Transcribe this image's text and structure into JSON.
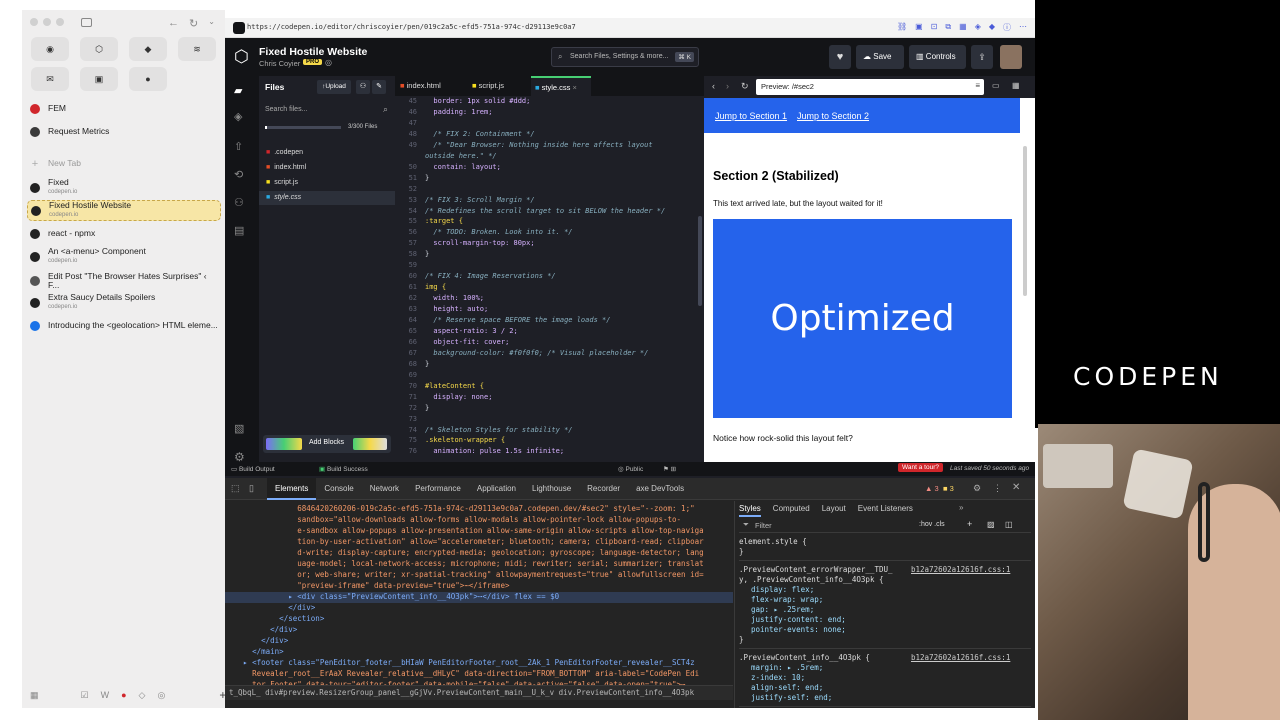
{
  "sidebar": {
    "pinned": [
      {
        "icon": "github-icon",
        "glyph": "◉",
        "bg": "#e2e1e1"
      },
      {
        "icon": "codepen-icon",
        "glyph": "⬡",
        "bg": "#e2e1e1"
      },
      {
        "icon": "app-icon-purple",
        "glyph": "◆",
        "bg": "#e2e1e1"
      },
      {
        "icon": "stack-icon",
        "glyph": "≋",
        "bg": "#e2e1e1"
      },
      {
        "icon": "app-icon-green",
        "glyph": "✉",
        "bg": "#e2e1e1"
      },
      {
        "icon": "app-icon-tile",
        "glyph": "▣",
        "bg": "#e2e1e1"
      },
      {
        "icon": "app-icon-red",
        "glyph": "●",
        "bg": "#e2e1e1"
      }
    ],
    "tabs": [
      {
        "label": "FEM",
        "sub": "",
        "color": "#d0262b"
      },
      {
        "label": "Request Metrics",
        "sub": "",
        "color": "#3a3a3a"
      },
      {
        "label": "New Tab",
        "sub": "",
        "color": "#bbb",
        "plus": true
      },
      {
        "label": "Fixed",
        "sub": "codepen.io",
        "color": "#222"
      },
      {
        "label": "Fixed Hostile Website",
        "sub": "codepen.io",
        "color": "#222",
        "active": true
      },
      {
        "label": "react - npmx",
        "sub": "",
        "color": "#222"
      },
      {
        "label": "An <a-menu> Component",
        "sub": "codepen.io",
        "color": "#222"
      },
      {
        "label": "Edit Post \"The Browser Hates Surprises\" ‹ F...",
        "sub": "",
        "color": "#555"
      },
      {
        "label": "Extra Saucy Details Spoilers",
        "sub": "codepen.io",
        "color": "#222"
      },
      {
        "label": "Introducing the <geolocation> HTML eleme...",
        "sub": "",
        "color": "#1a73e8"
      }
    ]
  },
  "url": "https://codepen.io/editor/chriscoyier/pen/019c2a5c-efd5-751a-974c-d29113e9c0a7",
  "pen": {
    "title": "Fixed Hostile Website",
    "author": "Chris Coyier",
    "badge": "PRO"
  },
  "header": {
    "search_placeholder": "Search Files, Settings & more...",
    "kbd": "⌘ K",
    "save": "Save",
    "controls": "Controls"
  },
  "files": {
    "title": "Files",
    "upload": "Upload",
    "search_placeholder": "Search files...",
    "count": "3/300 Files",
    "items": [
      ".codepen",
      "index.html",
      "script.js",
      "style.css"
    ],
    "add_blocks": "Add Blocks"
  },
  "editor_tabs": [
    "index.html",
    "script.js",
    "style.css"
  ],
  "code_lines": [
    {
      "n": "45",
      "t": "  border: 1px solid #ddd;"
    },
    {
      "n": "46",
      "t": "  padding: 1rem;"
    },
    {
      "n": "47",
      "t": ""
    },
    {
      "n": "48",
      "t": "  /* FIX 2: Containment */"
    },
    {
      "n": "49",
      "t": "  /* \"Dear Browser: Nothing inside here affects layout"
    },
    {
      "n": "",
      "t": "outside here.\" */"
    },
    {
      "n": "50",
      "t": "  contain: layout;"
    },
    {
      "n": "51",
      "t": "}"
    },
    {
      "n": "52",
      "t": ""
    },
    {
      "n": "53",
      "t": "/* FIX 3: Scroll Margin */"
    },
    {
      "n": "54",
      "t": "/* Redefines the scroll target to sit BELOW the header */"
    },
    {
      "n": "55",
      "t": ":target {"
    },
    {
      "n": "56",
      "t": "  /* TODO: Broken. Look into it. */"
    },
    {
      "n": "57",
      "t": "  scroll-margin-top: 80px;"
    },
    {
      "n": "58",
      "t": "}"
    },
    {
      "n": "59",
      "t": ""
    },
    {
      "n": "60",
      "t": "/* FIX 4: Image Reservations */"
    },
    {
      "n": "61",
      "t": "img {"
    },
    {
      "n": "62",
      "t": "  width: 100%;"
    },
    {
      "n": "63",
      "t": "  height: auto;"
    },
    {
      "n": "64",
      "t": "  /* Reserve space BEFORE the image loads */"
    },
    {
      "n": "65",
      "t": "  aspect-ratio: 3 / 2;"
    },
    {
      "n": "66",
      "t": "  object-fit: cover;"
    },
    {
      "n": "67",
      "t": "  background-color: #f0f0f0; /* Visual placeholder */"
    },
    {
      "n": "68",
      "t": "}"
    },
    {
      "n": "69",
      "t": ""
    },
    {
      "n": "70",
      "t": "#lateContent {"
    },
    {
      "n": "71",
      "t": "  display: none;"
    },
    {
      "n": "72",
      "t": "}"
    },
    {
      "n": "73",
      "t": ""
    },
    {
      "n": "74",
      "t": "/* Skeleton Styles for stability */"
    },
    {
      "n": "75",
      "t": ".skeleton-wrapper {"
    },
    {
      "n": "76",
      "t": "  animation: pulse 1.5s infinite;"
    }
  ],
  "preview": {
    "url": "Preview: /#sec2",
    "nav": [
      "Jump to Section 1",
      "Jump to Section 2"
    ],
    "heading": "Section 2 (Stabilized)",
    "text": "This text arrived late, but the layout waited for it!",
    "image_text": "Optimized",
    "note": "Notice how rock-solid this layout felt?"
  },
  "footer": {
    "build_output": "Build Output",
    "build_success": "Build Success",
    "public": "Public",
    "tour": "Want a tour?",
    "saved": "Last saved 50 seconds ago"
  },
  "devtools": {
    "tabs": [
      "Elements",
      "Console",
      "Network",
      "Performance",
      "Application",
      "Lighthouse",
      "Recorder",
      "axe DevTools"
    ],
    "badges": [
      "3",
      "3"
    ],
    "dom_lines": [
      "                6846420260206-019c2a5c-efd5-751a-974c-d29113e9c0a7.codepen.dev/#sec2\" style=\"--zoom: 1;\"",
      "                sandbox=\"allow-downloads allow-forms allow-modals allow-pointer-lock allow-popups-to-",
      "                e-sandbox allow-popups allow-presentation allow-same-origin allow-scripts allow-top-naviga",
      "                tion-by-user-activation\" allow=\"accelerometer; bluetooth; camera; clipboard-read; clipboar",
      "                d-write; display-capture; encrypted-media; geolocation; gyroscope; language-detector; lang",
      "                uage-model; local-network-access; microphone; midi; rewriter; serial; summarizer; translat",
      "                or; web-share; writer; xr-spatial-tracking\" allowpaymentrequest=\"true\" allowfullscreen id=",
      "                \"preview-iframe\" data-preview=\"true\">⋯</iframe>",
      "              ▸ <div class=\"PreviewContent_info__4O3pk\">⋯</div> flex == $0",
      "              </div>",
      "            </section>",
      "          </div>",
      "        </div>",
      "      </main>",
      "    ▸ <footer class=\"PenEditor_footer__bHIaW PenEditorFooter_root__2Ak_1 PenEditorFooter_revealer__SCT4z",
      "      Revealer_root__ErAaX Revealer_relative__dHLyC\" data-direction=\"FROM_BOTTOM\" aria-label=\"CodePen Edi",
      "      tor Footer\" data-tour=\"editor-footer\" data-mobile=\"false\" data-active=\"false\" data-open=\"true\">⋯"
    ],
    "breadcrumb": "t_QbqL_  div#preview.ResizerGroup_panel__gGjVv.PreviewContent_main__U_k_v  div.PreviewContent_info__4O3pk",
    "styles_tabs": [
      "Styles",
      "Computed",
      "Layout",
      "Event Listeners"
    ],
    "filter": "Filter",
    "hov": ":hov .cls",
    "rules": [
      {
        "sel": "element.style {",
        "src": "",
        "props": [],
        "close": "}"
      },
      {
        "sel": ".PreviewContent_errorWrapper__TDU_",
        "src": "b12a72602a12616f.css:1",
        "sel2": "y, .PreviewContent_info__4O3pk {",
        "props": [
          "display: flex;",
          "flex-wrap: wrap;",
          "gap: ▸ .25rem;",
          "justify-content: end;",
          "pointer-events: none;"
        ],
        "close": "}"
      },
      {
        "sel": ".PreviewContent_info__4O3pk {",
        "src": "b12a72602a12616f.css:1",
        "props": [
          "margin: ▸ .5rem;",
          "z-index: 10;",
          "align-self: end;",
          "justify-self: end;"
        ],
        "close": ""
      }
    ]
  },
  "brand": "CODEPEN"
}
